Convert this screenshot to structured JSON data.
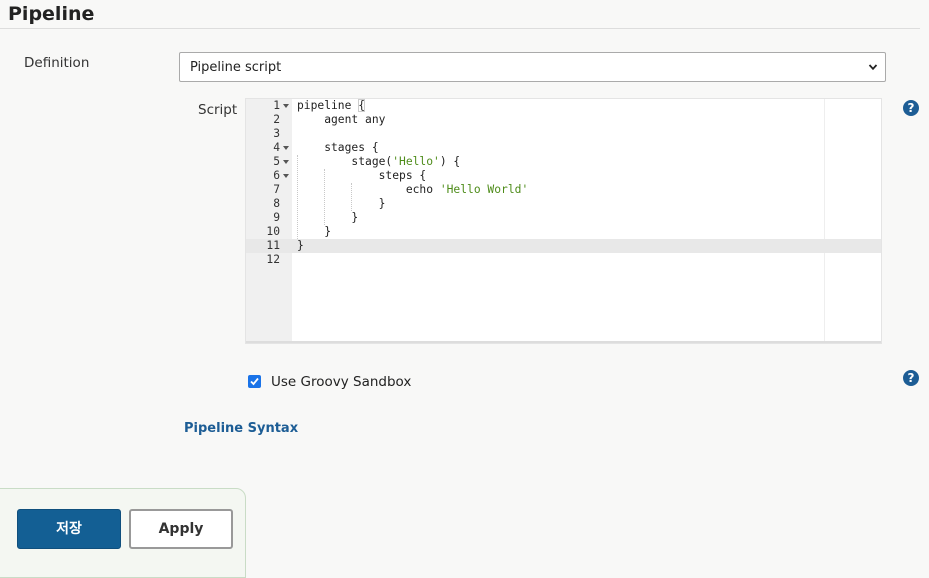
{
  "section": {
    "title": "Pipeline"
  },
  "definition": {
    "label": "Definition",
    "selected": "Pipeline script"
  },
  "script": {
    "label": "Script",
    "lines": [
      {
        "n": "1",
        "fold": true,
        "text": "pipeline {",
        "active": false
      },
      {
        "n": "2",
        "fold": false,
        "text": "    agent any",
        "active": false
      },
      {
        "n": "3",
        "fold": false,
        "text": "",
        "active": false
      },
      {
        "n": "4",
        "fold": true,
        "text": "    stages {",
        "active": false
      },
      {
        "n": "5",
        "fold": true,
        "text": "        stage('Hello') {",
        "active": false
      },
      {
        "n": "6",
        "fold": true,
        "text": "            steps {",
        "active": false
      },
      {
        "n": "7",
        "fold": false,
        "text": "                echo 'Hello World'",
        "active": false
      },
      {
        "n": "8",
        "fold": false,
        "text": "            }",
        "active": false
      },
      {
        "n": "9",
        "fold": false,
        "text": "        }",
        "active": false
      },
      {
        "n": "10",
        "fold": false,
        "text": "    }",
        "active": false
      },
      {
        "n": "11",
        "fold": false,
        "text": "}",
        "active": true
      },
      {
        "n": "12",
        "fold": false,
        "text": "",
        "active": false
      }
    ]
  },
  "sandbox": {
    "label": "Use Groovy Sandbox",
    "checked": true
  },
  "links": {
    "pipeline_syntax": "Pipeline Syntax"
  },
  "help": {
    "symbol": "?"
  },
  "buttons": {
    "save": "저장",
    "apply": "Apply"
  },
  "colors": {
    "accent": "#135f94",
    "link": "#1d5d95",
    "checkbox": "#1a73e8",
    "string": "#4e8c1a"
  }
}
